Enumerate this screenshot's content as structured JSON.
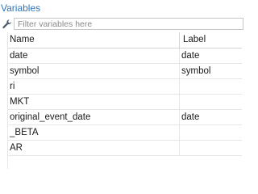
{
  "panel": {
    "title": "Variables"
  },
  "filter": {
    "placeholder": "Filter variables here",
    "value": "",
    "icon": "wrench-icon"
  },
  "table": {
    "columns": [
      "Name",
      "Label"
    ],
    "rows": [
      {
        "name": "date",
        "label": "date"
      },
      {
        "name": "symbol",
        "label": "symbol"
      },
      {
        "name": "ri",
        "label": ""
      },
      {
        "name": "MKT",
        "label": ""
      },
      {
        "name": "original_event_date",
        "label": "date"
      },
      {
        "name": "_BETA",
        "label": ""
      },
      {
        "name": "AR",
        "label": ""
      }
    ]
  },
  "colors": {
    "title": "#2e75b6",
    "grid_line": "#e6e6e6"
  }
}
